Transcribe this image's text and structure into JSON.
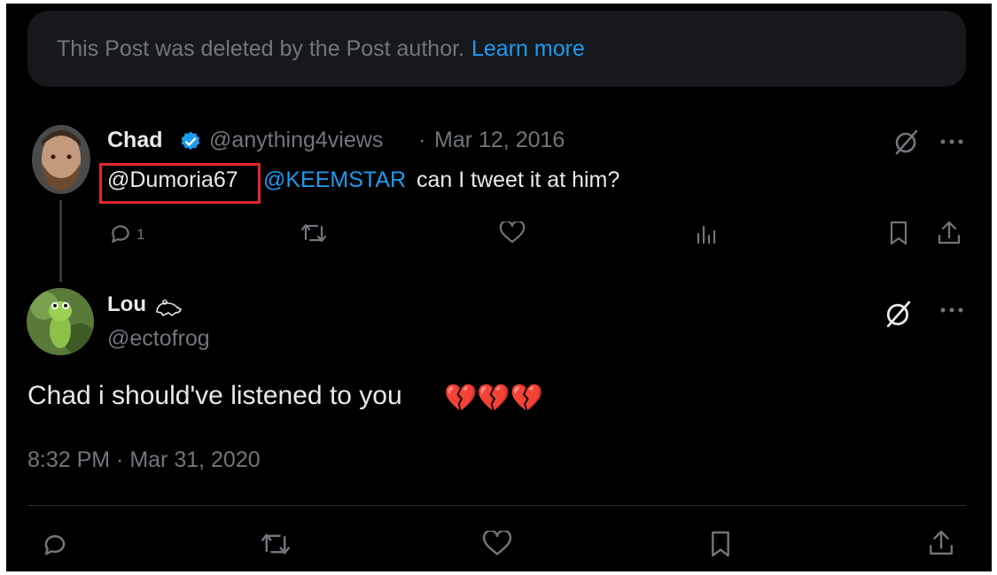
{
  "deleted_notice": {
    "text": "This Post was deleted by the Post author.",
    "link": "Learn more"
  },
  "reply_post": {
    "author_name": "Chad",
    "verified": true,
    "handle": "@anything4views",
    "separator": "·",
    "date": "Mar 12, 2016",
    "text_mention_1": "@Dumoria67",
    "text_mention_2": "@KEEMSTAR",
    "text_body": "can I tweet it at him?",
    "reply_count": "1"
  },
  "main_post": {
    "author_name": "Lou",
    "handle": "@ectofrog",
    "text": "Chad i should've listened to you",
    "emoji": [
      "💔",
      "💔",
      "💔"
    ],
    "timestamp": "8:32 PM · Mar 31, 2020"
  },
  "colors": {
    "background": "#000000",
    "accent": "#1d9bf0",
    "muted": "#71767b",
    "highlight": "#e0272d"
  },
  "icons": [
    "grok-icon",
    "more-icon",
    "reply-icon",
    "repost-icon",
    "like-icon",
    "views-icon",
    "bookmark-icon",
    "share-icon",
    "verified-icon",
    "frog-emoji-icon"
  ]
}
